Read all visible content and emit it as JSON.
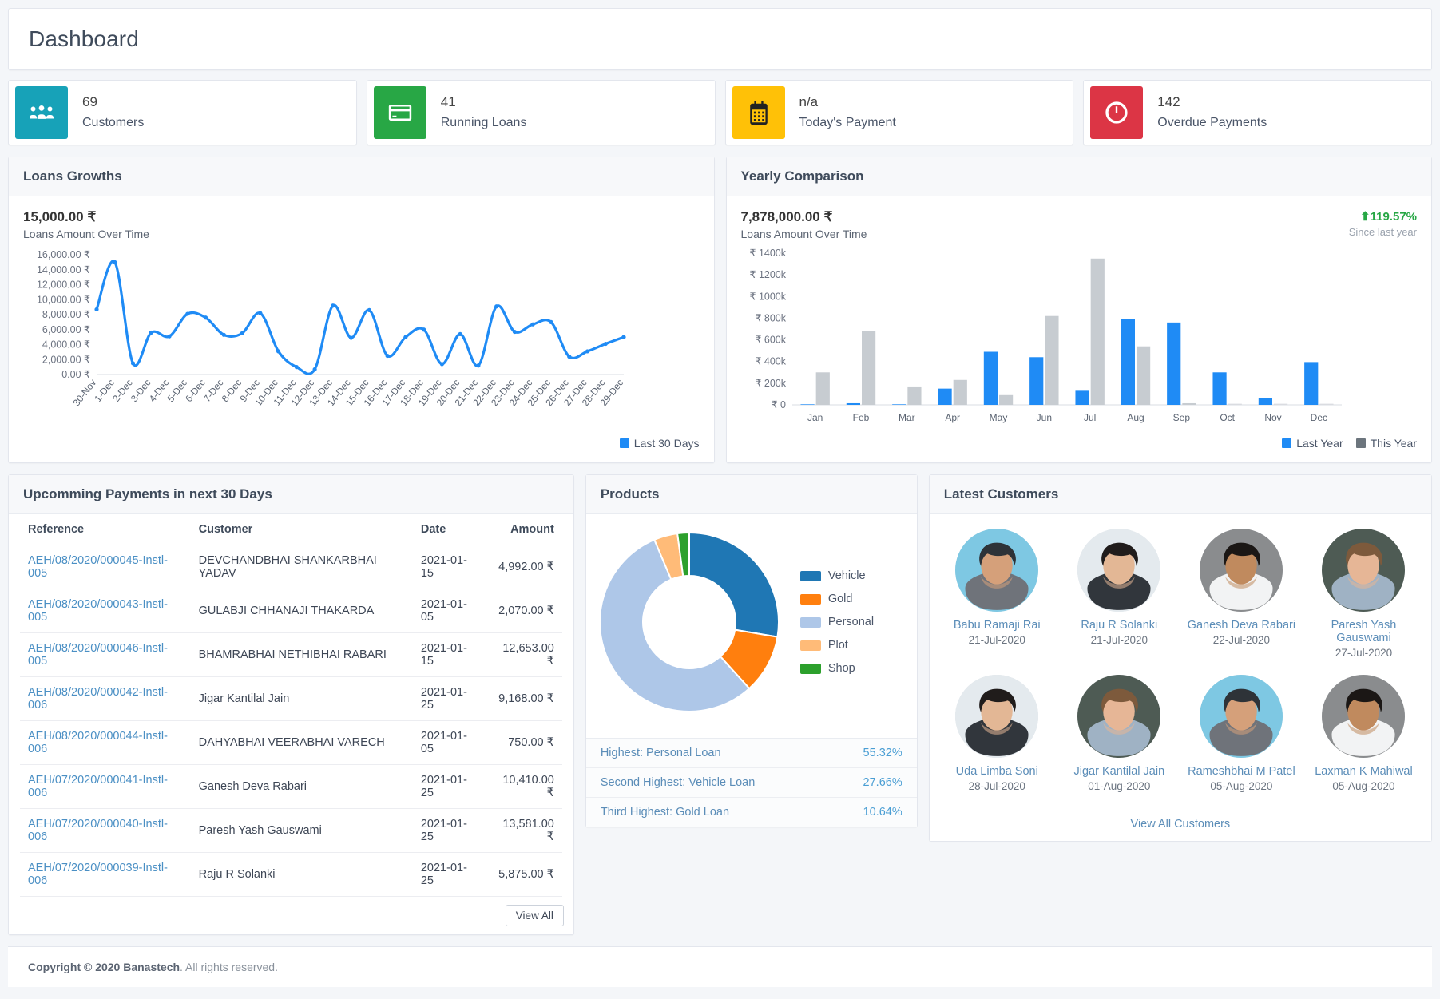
{
  "header": {
    "title": "Dashboard"
  },
  "stats": [
    {
      "value": "69",
      "label": "Customers",
      "color": "#17a2b8",
      "icon": "users-icon"
    },
    {
      "value": "41",
      "label": "Running Loans",
      "color": "#28a745",
      "icon": "credit-card-icon"
    },
    {
      "value": "n/a",
      "label": "Today's Payment",
      "color": "#ffc107",
      "icon": "calendar-icon"
    },
    {
      "value": "142",
      "label": "Overdue Payments",
      "color": "#dc3545",
      "icon": "clock-icon"
    }
  ],
  "loans_growth": {
    "title": "Loans Growths",
    "amount": "15,000.00 ₹",
    "subtitle": "Loans Amount Over Time",
    "legend": [
      {
        "label": "Last 30 Days",
        "color": "#1f8bf5"
      }
    ]
  },
  "yearly": {
    "title": "Yearly Comparison",
    "amount": "7,878,000.00 ₹",
    "subtitle": "Loans Amount Over Time",
    "delta": "119.57%",
    "delta_caption": "Since last year",
    "delta_color": "#27a745",
    "legend": [
      {
        "label": "Last Year",
        "color": "#1f8bf5"
      },
      {
        "label": "This Year",
        "color": "#6c757d"
      }
    ]
  },
  "payments": {
    "title": "Upcomming Payments in next 30 Days",
    "columns": [
      "Reference",
      "Customer",
      "Date",
      "Amount"
    ],
    "rows": [
      {
        "reference": "AEH/08/2020/000045-Instl-005",
        "customer": "DEVCHANDBHAI SHANKARBHAI YADAV",
        "date": "2021-01-15",
        "amount": "4,992.00 ₹"
      },
      {
        "reference": "AEH/08/2020/000043-Instl-005",
        "customer": "GULABJI CHHANAJI THAKARDA",
        "date": "2021-01-05",
        "amount": "2,070.00 ₹"
      },
      {
        "reference": "AEH/08/2020/000046-Instl-005",
        "customer": "BHAMRABHAI NETHIBHAI RABARI",
        "date": "2021-01-15",
        "amount": "12,653.00 ₹"
      },
      {
        "reference": "AEH/08/2020/000042-Instl-006",
        "customer": "Jigar Kantilal Jain",
        "date": "2021-01-25",
        "amount": "9,168.00 ₹"
      },
      {
        "reference": "AEH/08/2020/000044-Instl-006",
        "customer": "DAHYABHAI VEERABHAI VARECH",
        "date": "2021-01-05",
        "amount": "750.00 ₹"
      },
      {
        "reference": "AEH/07/2020/000041-Instl-006",
        "customer": "Ganesh Deva Rabari",
        "date": "2021-01-25",
        "amount": "10,410.00 ₹"
      },
      {
        "reference": "AEH/07/2020/000040-Instl-006",
        "customer": "Paresh Yash Gauswami",
        "date": "2021-01-25",
        "amount": "13,581.00 ₹"
      },
      {
        "reference": "AEH/07/2020/000039-Instl-006",
        "customer": "Raju R Solanki",
        "date": "2021-01-25",
        "amount": "5,875.00 ₹"
      }
    ],
    "view_all": "View All"
  },
  "products": {
    "title": "Products",
    "rows": [
      {
        "label": "Highest: Personal Loan",
        "value": "55.32%"
      },
      {
        "label": "Second Highest: Vehicle Loan",
        "value": "27.66%"
      },
      {
        "label": "Third Highest: Gold Loan",
        "value": "10.64%"
      }
    ]
  },
  "customers": {
    "title": "Latest Customers",
    "view_all": "View All Customers",
    "items": [
      {
        "name": "Babu Ramaji Rai",
        "date": "21-Jul-2020",
        "bg": "#7ec8e3",
        "skin": "#d5a07a",
        "hair": "#2e3338",
        "shirt": "#6f737a"
      },
      {
        "name": "Raju R Solanki",
        "date": "21-Jul-2020",
        "bg": "#e4eaee",
        "skin": "#e3b795",
        "hair": "#201c1b",
        "shirt": "#31363c"
      },
      {
        "name": "Ganesh Deva Rabari",
        "date": "22-Jul-2020",
        "bg": "#8a8c8e",
        "skin": "#c08a5e",
        "hair": "#1b1715",
        "shirt": "#f2f3f4"
      },
      {
        "name": "Paresh Yash Gauswami",
        "date": "27-Jul-2020",
        "bg": "#4e5b54",
        "skin": "#e6b696",
        "hair": "#7d5a3c",
        "shirt": "#9fb2c4"
      },
      {
        "name": "Uda Limba Soni",
        "date": "28-Jul-2020",
        "bg": "#e4eaee",
        "skin": "#e3b795",
        "hair": "#201c1b",
        "shirt": "#31363c"
      },
      {
        "name": "Jigar Kantilal Jain",
        "date": "01-Aug-2020",
        "bg": "#4e5b54",
        "skin": "#e6b696",
        "hair": "#7d5a3c",
        "shirt": "#9fb2c4"
      },
      {
        "name": "Rameshbhai M Patel",
        "date": "05-Aug-2020",
        "bg": "#7ec8e3",
        "skin": "#d5a07a",
        "hair": "#2e3338",
        "shirt": "#6f737a"
      },
      {
        "name": "Laxman K Mahiwal",
        "date": "05-Aug-2020",
        "bg": "#8a8c8e",
        "skin": "#c08a5e",
        "hair": "#1b1715",
        "shirt": "#f2f3f4"
      }
    ]
  },
  "footer": {
    "copyright": "Copyright © 2020 ",
    "brand": "Banastech",
    "rights": ". All rights reserved."
  },
  "chart_data": [
    {
      "type": "line",
      "title": "Loans Growths",
      "ylabel": "",
      "xlabel": "",
      "series_name": "Last 30 Days",
      "color": "#1f8bf5",
      "ylim": [
        0,
        16000
      ],
      "yticks": [
        0,
        2000,
        4000,
        6000,
        8000,
        10000,
        12000,
        14000,
        16000
      ],
      "ytick_labels": [
        "0.00 ₹",
        "2,000.00 ₹",
        "4,000.00 ₹",
        "6,000.00 ₹",
        "8,000.00 ₹",
        "10,000.00 ₹",
        "12,000.00 ₹",
        "14,000.00 ₹",
        "16,000.00 ₹"
      ],
      "x": [
        "30-Nov",
        "1-Dec",
        "2-Dec",
        "3-Dec",
        "4-Dec",
        "5-Dec",
        "6-Dec",
        "7-Dec",
        "8-Dec",
        "9-Dec",
        "10-Dec",
        "11-Dec",
        "12-Dec",
        "13-Dec",
        "14-Dec",
        "15-Dec",
        "16-Dec",
        "17-Dec",
        "18-Dec",
        "19-Dec",
        "20-Dec",
        "21-Dec",
        "22-Dec",
        "23-Dec",
        "24-Dec",
        "25-Dec",
        "26-Dec",
        "27-Dec",
        "28-Dec",
        "29-Dec"
      ],
      "values": [
        8700,
        15000,
        1500,
        5600,
        5100,
        8100,
        7600,
        5300,
        5500,
        8200,
        3100,
        1000,
        700,
        9200,
        4900,
        8600,
        2500,
        5000,
        6000,
        1400,
        5400,
        1200,
        9100,
        5700,
        6700,
        7000,
        2400,
        3100,
        4100,
        5000
      ],
      "grid": false,
      "legend_position": "bottom-right"
    },
    {
      "type": "bar",
      "title": "Yearly Comparison",
      "categories": [
        "Jan",
        "Feb",
        "Mar",
        "Apr",
        "May",
        "Jun",
        "Jul",
        "Aug",
        "Sep",
        "Oct",
        "Nov",
        "Dec"
      ],
      "series": [
        {
          "name": "Last Year",
          "color": "#1f8bf5",
          "values": [
            5,
            15,
            5,
            150,
            490,
            440,
            130,
            790,
            760,
            300,
            60,
            395
          ]
        },
        {
          "name": "This Year",
          "color": "#c7ccd1",
          "values": [
            300,
            680,
            170,
            230,
            90,
            820,
            1350,
            540,
            15,
            0,
            0,
            0
          ]
        }
      ],
      "ylim": [
        0,
        1400
      ],
      "yticks": [
        0,
        200,
        400,
        600,
        800,
        1000,
        1200,
        1400
      ],
      "ytick_labels": [
        "₹ 0",
        "₹ 200k",
        "₹ 400k",
        "₹ 600k",
        "₹ 800k",
        "₹ 1000k",
        "₹ 1200k",
        "₹ 1400k"
      ],
      "xlabel": "",
      "ylabel": "",
      "grid": false,
      "legend_position": "bottom-right"
    },
    {
      "type": "pie",
      "title": "Products",
      "labels": [
        "Vehicle",
        "Gold",
        "Personal",
        "Plot",
        "Shop"
      ],
      "values": [
        27.66,
        10.64,
        55.32,
        4.26,
        2.12
      ],
      "colors": [
        "#1f77b4",
        "#ff7f0e",
        "#aec7e8",
        "#ffbb78",
        "#2ca02c"
      ],
      "donut": true,
      "legend_position": "right"
    }
  ]
}
